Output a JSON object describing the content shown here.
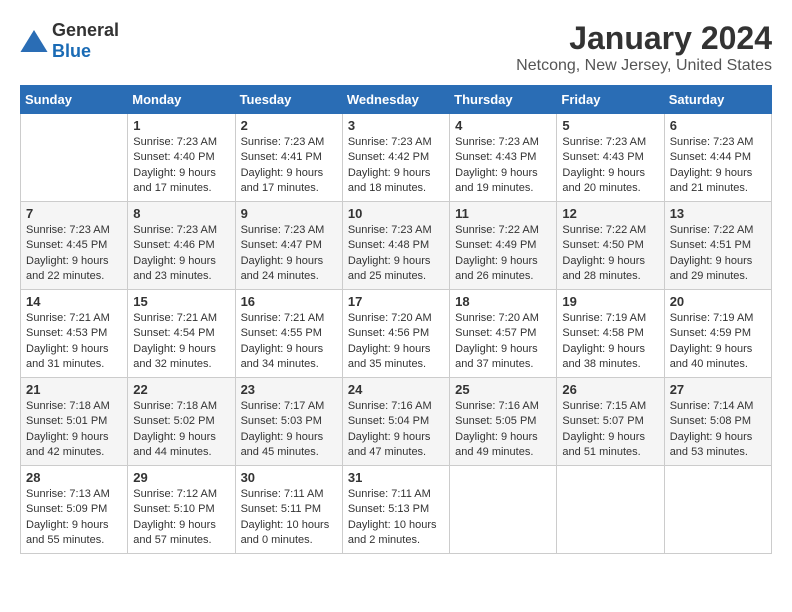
{
  "header": {
    "logo_general": "General",
    "logo_blue": "Blue",
    "month_year": "January 2024",
    "location": "Netcong, New Jersey, United States"
  },
  "days_of_week": [
    "Sunday",
    "Monday",
    "Tuesday",
    "Wednesday",
    "Thursday",
    "Friday",
    "Saturday"
  ],
  "weeks": [
    [
      {
        "day": "",
        "empty": true
      },
      {
        "day": "1",
        "sunrise": "Sunrise: 7:23 AM",
        "sunset": "Sunset: 4:40 PM",
        "daylight": "Daylight: 9 hours and 17 minutes."
      },
      {
        "day": "2",
        "sunrise": "Sunrise: 7:23 AM",
        "sunset": "Sunset: 4:41 PM",
        "daylight": "Daylight: 9 hours and 17 minutes."
      },
      {
        "day": "3",
        "sunrise": "Sunrise: 7:23 AM",
        "sunset": "Sunset: 4:42 PM",
        "daylight": "Daylight: 9 hours and 18 minutes."
      },
      {
        "day": "4",
        "sunrise": "Sunrise: 7:23 AM",
        "sunset": "Sunset: 4:43 PM",
        "daylight": "Daylight: 9 hours and 19 minutes."
      },
      {
        "day": "5",
        "sunrise": "Sunrise: 7:23 AM",
        "sunset": "Sunset: 4:43 PM",
        "daylight": "Daylight: 9 hours and 20 minutes."
      },
      {
        "day": "6",
        "sunrise": "Sunrise: 7:23 AM",
        "sunset": "Sunset: 4:44 PM",
        "daylight": "Daylight: 9 hours and 21 minutes."
      }
    ],
    [
      {
        "day": "7",
        "sunrise": "Sunrise: 7:23 AM",
        "sunset": "Sunset: 4:45 PM",
        "daylight": "Daylight: 9 hours and 22 minutes."
      },
      {
        "day": "8",
        "sunrise": "Sunrise: 7:23 AM",
        "sunset": "Sunset: 4:46 PM",
        "daylight": "Daylight: 9 hours and 23 minutes."
      },
      {
        "day": "9",
        "sunrise": "Sunrise: 7:23 AM",
        "sunset": "Sunset: 4:47 PM",
        "daylight": "Daylight: 9 hours and 24 minutes."
      },
      {
        "day": "10",
        "sunrise": "Sunrise: 7:23 AM",
        "sunset": "Sunset: 4:48 PM",
        "daylight": "Daylight: 9 hours and 25 minutes."
      },
      {
        "day": "11",
        "sunrise": "Sunrise: 7:22 AM",
        "sunset": "Sunset: 4:49 PM",
        "daylight": "Daylight: 9 hours and 26 minutes."
      },
      {
        "day": "12",
        "sunrise": "Sunrise: 7:22 AM",
        "sunset": "Sunset: 4:50 PM",
        "daylight": "Daylight: 9 hours and 28 minutes."
      },
      {
        "day": "13",
        "sunrise": "Sunrise: 7:22 AM",
        "sunset": "Sunset: 4:51 PM",
        "daylight": "Daylight: 9 hours and 29 minutes."
      }
    ],
    [
      {
        "day": "14",
        "sunrise": "Sunrise: 7:21 AM",
        "sunset": "Sunset: 4:53 PM",
        "daylight": "Daylight: 9 hours and 31 minutes."
      },
      {
        "day": "15",
        "sunrise": "Sunrise: 7:21 AM",
        "sunset": "Sunset: 4:54 PM",
        "daylight": "Daylight: 9 hours and 32 minutes."
      },
      {
        "day": "16",
        "sunrise": "Sunrise: 7:21 AM",
        "sunset": "Sunset: 4:55 PM",
        "daylight": "Daylight: 9 hours and 34 minutes."
      },
      {
        "day": "17",
        "sunrise": "Sunrise: 7:20 AM",
        "sunset": "Sunset: 4:56 PM",
        "daylight": "Daylight: 9 hours and 35 minutes."
      },
      {
        "day": "18",
        "sunrise": "Sunrise: 7:20 AM",
        "sunset": "Sunset: 4:57 PM",
        "daylight": "Daylight: 9 hours and 37 minutes."
      },
      {
        "day": "19",
        "sunrise": "Sunrise: 7:19 AM",
        "sunset": "Sunset: 4:58 PM",
        "daylight": "Daylight: 9 hours and 38 minutes."
      },
      {
        "day": "20",
        "sunrise": "Sunrise: 7:19 AM",
        "sunset": "Sunset: 4:59 PM",
        "daylight": "Daylight: 9 hours and 40 minutes."
      }
    ],
    [
      {
        "day": "21",
        "sunrise": "Sunrise: 7:18 AM",
        "sunset": "Sunset: 5:01 PM",
        "daylight": "Daylight: 9 hours and 42 minutes."
      },
      {
        "day": "22",
        "sunrise": "Sunrise: 7:18 AM",
        "sunset": "Sunset: 5:02 PM",
        "daylight": "Daylight: 9 hours and 44 minutes."
      },
      {
        "day": "23",
        "sunrise": "Sunrise: 7:17 AM",
        "sunset": "Sunset: 5:03 PM",
        "daylight": "Daylight: 9 hours and 45 minutes."
      },
      {
        "day": "24",
        "sunrise": "Sunrise: 7:16 AM",
        "sunset": "Sunset: 5:04 PM",
        "daylight": "Daylight: 9 hours and 47 minutes."
      },
      {
        "day": "25",
        "sunrise": "Sunrise: 7:16 AM",
        "sunset": "Sunset: 5:05 PM",
        "daylight": "Daylight: 9 hours and 49 minutes."
      },
      {
        "day": "26",
        "sunrise": "Sunrise: 7:15 AM",
        "sunset": "Sunset: 5:07 PM",
        "daylight": "Daylight: 9 hours and 51 minutes."
      },
      {
        "day": "27",
        "sunrise": "Sunrise: 7:14 AM",
        "sunset": "Sunset: 5:08 PM",
        "daylight": "Daylight: 9 hours and 53 minutes."
      }
    ],
    [
      {
        "day": "28",
        "sunrise": "Sunrise: 7:13 AM",
        "sunset": "Sunset: 5:09 PM",
        "daylight": "Daylight: 9 hours and 55 minutes."
      },
      {
        "day": "29",
        "sunrise": "Sunrise: 7:12 AM",
        "sunset": "Sunset: 5:10 PM",
        "daylight": "Daylight: 9 hours and 57 minutes."
      },
      {
        "day": "30",
        "sunrise": "Sunrise: 7:11 AM",
        "sunset": "Sunset: 5:11 PM",
        "daylight": "Daylight: 10 hours and 0 minutes."
      },
      {
        "day": "31",
        "sunrise": "Sunrise: 7:11 AM",
        "sunset": "Sunset: 5:13 PM",
        "daylight": "Daylight: 10 hours and 2 minutes."
      },
      {
        "day": "",
        "empty": true
      },
      {
        "day": "",
        "empty": true
      },
      {
        "day": "",
        "empty": true
      }
    ]
  ]
}
